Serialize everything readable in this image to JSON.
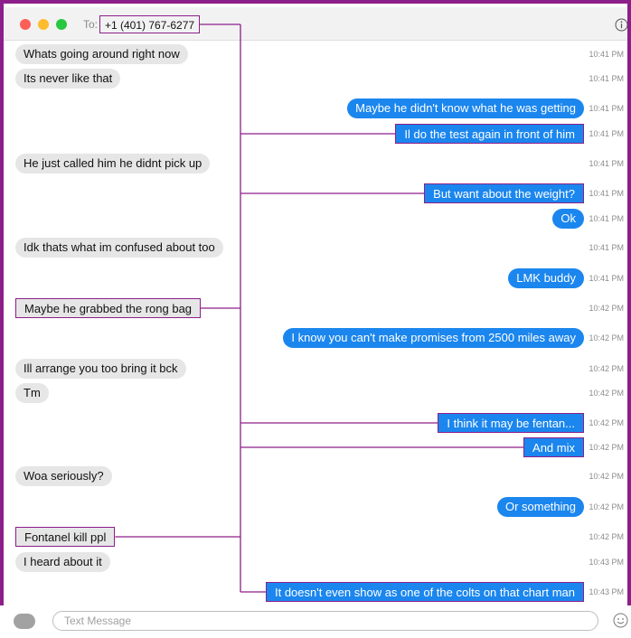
{
  "header": {
    "to_label": "To:",
    "recipient": "+1 (401) 767-6277"
  },
  "icons": {
    "info": "info-circle-icon",
    "apps": "app-store-icon",
    "emoji": "smiley-icon"
  },
  "colors": {
    "outgoing_bubble": "#1b86ee",
    "incoming_bubble": "#e6e6e6",
    "annotation": "#8d1f8a"
  },
  "messages": [
    {
      "dir": "in",
      "text": "Whats going around right now",
      "time": "10:41 PM",
      "hl": false
    },
    {
      "dir": "in",
      "text": "Its never like that",
      "time": "10:41 PM",
      "hl": false
    },
    {
      "dir": "out",
      "text": "Maybe he didn't know what he was getting",
      "time": "10:41 PM",
      "hl": false
    },
    {
      "dir": "out",
      "text": "Il do the test again in front of him",
      "time": "10:41 PM",
      "hl": true
    },
    {
      "dir": "in",
      "text": "He just called him he didnt pick up",
      "time": "10:41 PM",
      "hl": false
    },
    {
      "dir": "out",
      "text": "But want about the weight?",
      "time": "10:41 PM",
      "hl": true
    },
    {
      "dir": "out",
      "text": "Ok",
      "time": "10:41 PM",
      "hl": false
    },
    {
      "dir": "in",
      "text": "Idk thats what im confused about too",
      "time": "10:41 PM",
      "hl": false
    },
    {
      "dir": "out",
      "text": "LMK buddy",
      "time": "10:41 PM",
      "hl": false
    },
    {
      "dir": "in",
      "text": "Maybe he grabbed the rong bag",
      "time": "10:42 PM",
      "hl": true
    },
    {
      "dir": "out",
      "text": "I know you can't make promises from 2500 miles away",
      "time": "10:42 PM",
      "hl": false
    },
    {
      "dir": "in",
      "text": "Ill arrange you too bring it bck",
      "time": "10:42 PM",
      "hl": false
    },
    {
      "dir": "in",
      "text": "Tm",
      "time": "10:42 PM",
      "hl": false
    },
    {
      "dir": "out",
      "text": "I think it may be fentan...",
      "time": "10:42 PM",
      "hl": true
    },
    {
      "dir": "out",
      "text": "And mix",
      "time": "10:42 PM",
      "hl": true
    },
    {
      "dir": "in",
      "text": "Woa seriously?",
      "time": "10:42 PM",
      "hl": false
    },
    {
      "dir": "out",
      "text": "Or something",
      "time": "10:42 PM",
      "hl": false
    },
    {
      "dir": "in",
      "text": "Fontanel kill ppl",
      "time": "10:42 PM",
      "hl": true
    },
    {
      "dir": "in",
      "text": "I heard about it",
      "time": "10:43 PM",
      "hl": false
    },
    {
      "dir": "out",
      "text": "It doesn't even show as one of the colts on that chart man",
      "time": "10:43 PM",
      "hl": true
    }
  ],
  "composer": {
    "placeholder": "Text Message"
  }
}
